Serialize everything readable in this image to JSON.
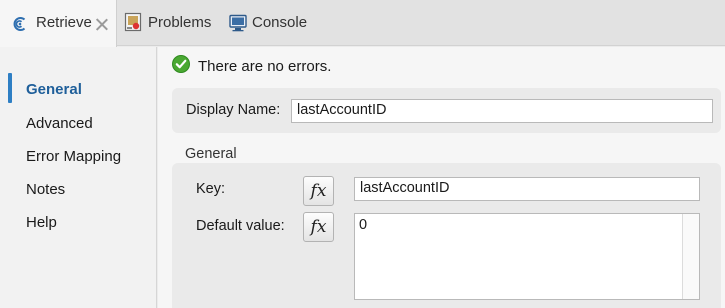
{
  "tabs": [
    {
      "label": "Retrieve",
      "icon": "retrieve-icon",
      "active": true
    },
    {
      "label": "Problems",
      "icon": "problems-icon",
      "active": false
    },
    {
      "label": "Console",
      "icon": "console-icon",
      "active": false
    }
  ],
  "nav": {
    "items": [
      {
        "label": "General",
        "active": true
      },
      {
        "label": "Advanced"
      },
      {
        "label": "Error Mapping"
      },
      {
        "label": "Notes"
      },
      {
        "label": "Help"
      }
    ]
  },
  "status": {
    "text": "There are no errors.",
    "icon": "success-check-icon",
    "color": "#4aa832"
  },
  "display_name": {
    "label": "Display Name:",
    "value": "lastAccountID"
  },
  "general_group": {
    "title": "General",
    "key": {
      "label": "Key:",
      "fx": "fx",
      "value": "lastAccountID"
    },
    "default_value": {
      "label": "Default value:",
      "fx": "fx",
      "value": "0"
    }
  },
  "colors": {
    "accent": "#2e7fc4",
    "nav_active_text": "#1f5f9a"
  }
}
